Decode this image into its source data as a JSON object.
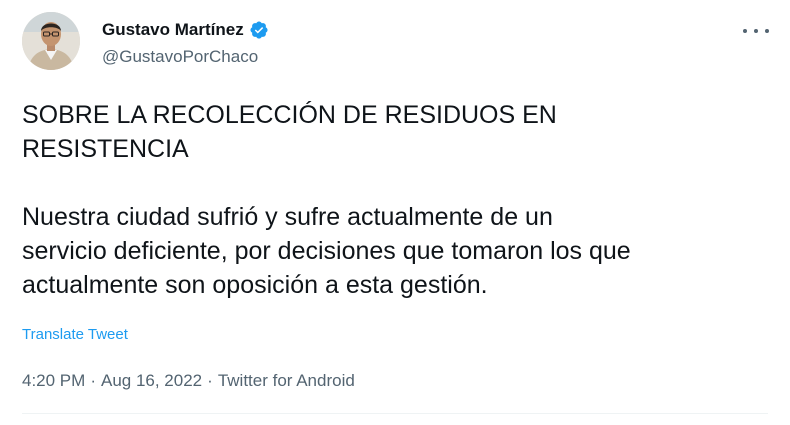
{
  "author": {
    "name": "Gustavo Martínez",
    "handle": "@GustavoPorChaco",
    "verified": true
  },
  "tweet": {
    "line1": "SOBRE LA RECOLECCIÓN DE RESIDUOS EN",
    "line2": "RESISTENCIA",
    "line3": "Nuestra ciudad sufrió y sufre actualmente de un",
    "line4": "servicio deficiente, por decisiones que tomaron los que",
    "line5": "actualmente son oposición a esta gestión."
  },
  "translate_label": "Translate Tweet",
  "meta": {
    "time": "4:20 PM",
    "separator": "·",
    "date": "Aug 16, 2022",
    "source": "Twitter for Android"
  },
  "icons": {
    "verified": "verified-badge-icon",
    "more": "more-options-icon"
  },
  "colors": {
    "accent": "#1d9bf0",
    "text": "#0f1419",
    "secondary": "#536471"
  }
}
